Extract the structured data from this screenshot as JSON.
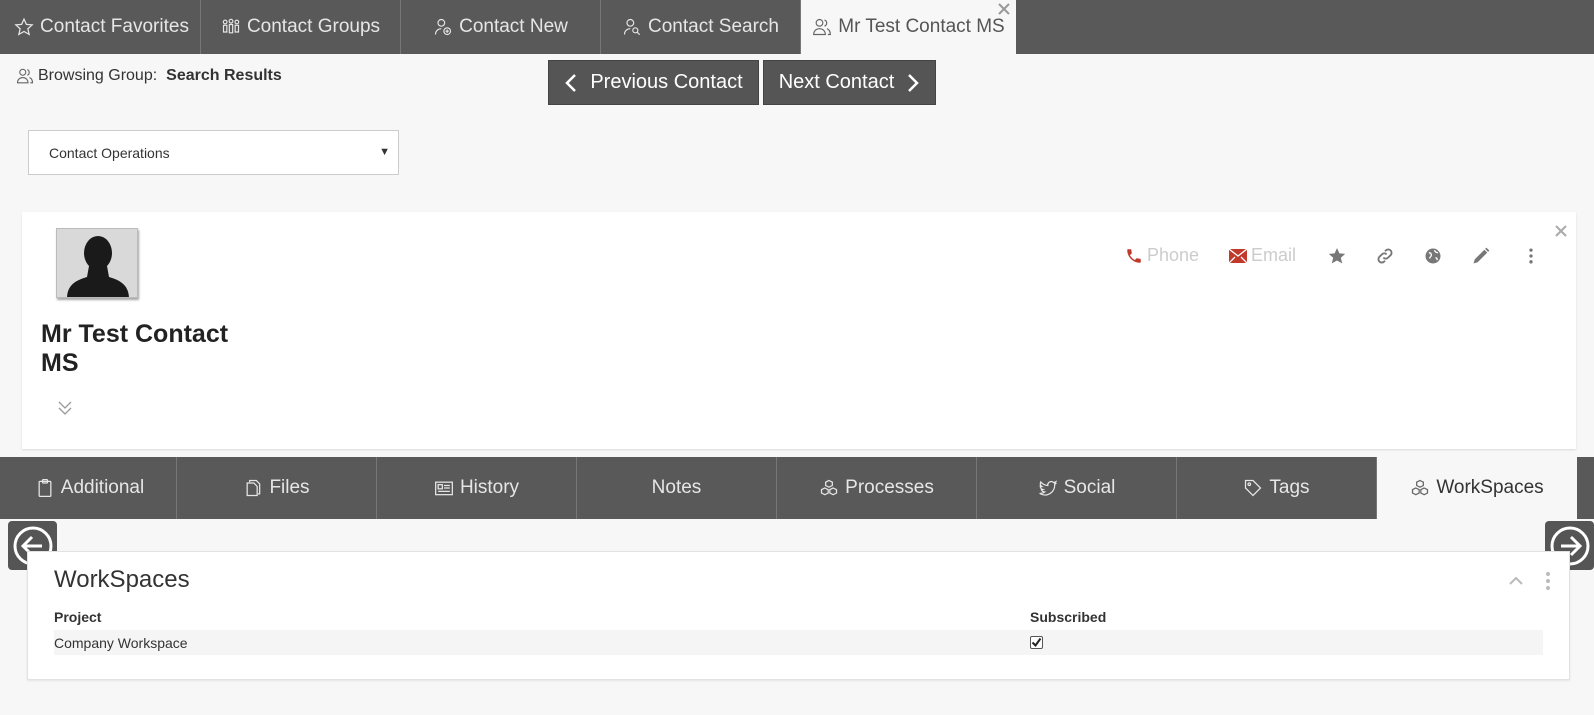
{
  "top_tabs": [
    {
      "label": "Contact Favorites",
      "icon": "star-icon"
    },
    {
      "label": "Contact Groups",
      "icon": "group-icon"
    },
    {
      "label": "Contact New",
      "icon": "user-add-icon"
    },
    {
      "label": "Contact Search",
      "icon": "user-search-icon"
    },
    {
      "label": "Mr Test Contact MS",
      "icon": "users-icon",
      "active": true
    }
  ],
  "browsing": {
    "prefix": "Browsing Group:",
    "group": "Search Results"
  },
  "nav": {
    "previous": "Previous Contact",
    "next": "Next Contact"
  },
  "operations": {
    "selected": "Contact Operations"
  },
  "contact": {
    "name": "Mr Test Contact MS",
    "phone_label": "Phone",
    "email_label": "Email"
  },
  "section_tabs": [
    {
      "label": "Additional",
      "icon": "clipboard-icon"
    },
    {
      "label": "Files",
      "icon": "file-icon"
    },
    {
      "label": "History",
      "icon": "history-icon"
    },
    {
      "label": "Notes",
      "icon": ""
    },
    {
      "label": "Processes",
      "icon": "processes-icon"
    },
    {
      "label": "Social",
      "icon": "twitter-icon"
    },
    {
      "label": "Tags",
      "icon": "tag-icon"
    },
    {
      "label": "WorkSpaces",
      "icon": "workspaces-icon",
      "active": true
    }
  ],
  "workspaces": {
    "title": "WorkSpaces",
    "columns": [
      "Project",
      "Subscribed"
    ],
    "rows": [
      {
        "project": "Company Workspace",
        "subscribed": true
      }
    ]
  },
  "colors": {
    "bar": "#595959",
    "accent_red": "#c0392b",
    "background": "#f7f7f7"
  }
}
